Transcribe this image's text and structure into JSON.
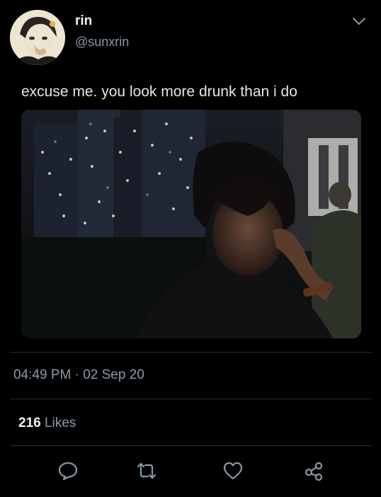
{
  "colors": {
    "background": "#000000",
    "primary_text": "#e6e6e6",
    "secondary_text": "#8899a6",
    "icon": "#8899a6",
    "divider": "#2a2d30"
  },
  "author": {
    "display_name": "rin",
    "handle": "@sunxrin",
    "avatar_icon": "avatar-illustration"
  },
  "menu": {
    "icon": "chevron-down-icon"
  },
  "tweet": {
    "text": "excuse me. you look more drunk than i do",
    "media": {
      "type": "photo",
      "icon": "photo-of-person-at-night-rooftop"
    },
    "timestamp": "04:49 PM · 02 Sep 20"
  },
  "stats": {
    "likes_count": "216",
    "likes_label": "Likes"
  },
  "actions": [
    {
      "name": "reply",
      "icon": "reply-bubble-icon"
    },
    {
      "name": "retweet",
      "icon": "retweet-icon"
    },
    {
      "name": "like",
      "icon": "heart-icon"
    },
    {
      "name": "share",
      "icon": "share-icon"
    }
  ]
}
